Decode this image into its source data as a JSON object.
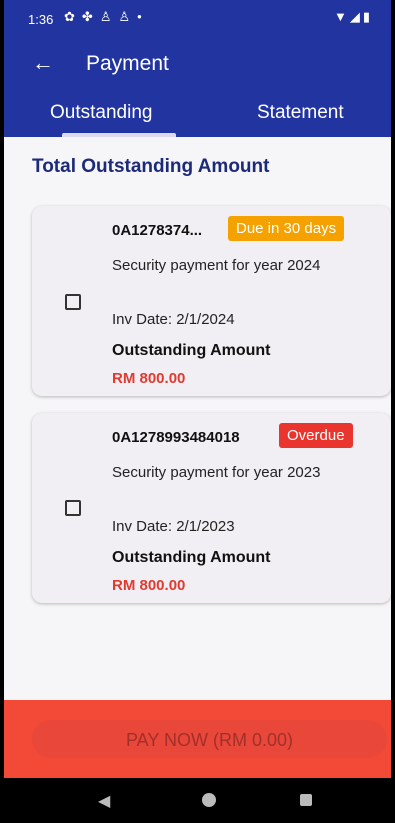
{
  "status_bar": {
    "time": "1:36",
    "left_icons": [
      "settings-icon",
      "gesture-icon",
      "accessibility-icon",
      "accessibility-icon",
      "dot-icon"
    ],
    "right_icons": [
      "wifi-icon",
      "signal-icon",
      "battery-icon"
    ]
  },
  "appbar": {
    "title": "Payment",
    "back_icon": "arrow-left-icon",
    "background": "#2234a0"
  },
  "tabs": [
    {
      "label": "Outstanding",
      "selected": true
    },
    {
      "label": "Statement",
      "selected": false
    }
  ],
  "section_title": "Total Outstanding Amount",
  "invoices": [
    {
      "number": "0A1278374...",
      "badge": "Due in 30 days",
      "badge_color": "#f5a200",
      "description": "Security payment for year 2024",
      "inv_date": "Inv Date: 2/1/2024",
      "amount_label": "Outstanding Amount",
      "amount": "RM 800.00",
      "checked": false
    },
    {
      "number": "0A1278993484018",
      "badge": "Overdue",
      "badge_color": "#e9352d",
      "description": "Security payment for year 2023",
      "inv_date": "Inv Date: 2/1/2023",
      "amount_label": "Outstanding Amount",
      "amount": "RM 800.00",
      "checked": false
    }
  ],
  "pay_button": {
    "label": "PAY NOW (RM 0.00)",
    "enabled": false,
    "color": "#f24a36"
  },
  "nav_bar": {
    "icons": [
      "nav-back-icon",
      "nav-home-icon",
      "nav-recents-icon"
    ]
  }
}
